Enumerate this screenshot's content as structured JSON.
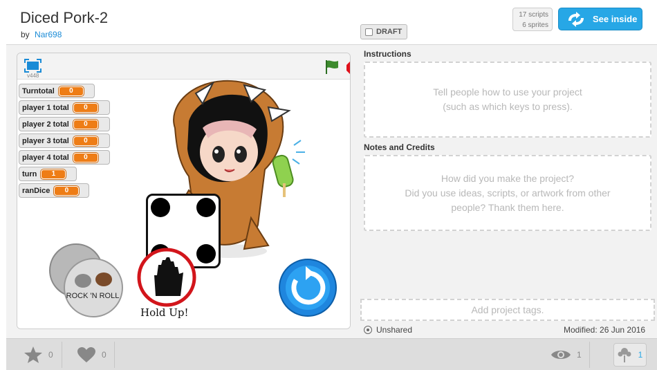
{
  "header": {
    "title": "Diced Pork-2",
    "by_label": "by",
    "author": "Nar698",
    "draft_label": "DRAFT",
    "scripts_count": "17 scripts",
    "sprites_count": "6 sprites",
    "see_inside_label": "See inside"
  },
  "player": {
    "version": "v448",
    "variables": [
      {
        "name": "Turntotal",
        "value": "0"
      },
      {
        "name": "player 1 total",
        "value": "0"
      },
      {
        "name": "player 2 total",
        "value": "0"
      },
      {
        "name": "player 3 total",
        "value": "0"
      },
      {
        "name": "player 4 total",
        "value": "0"
      },
      {
        "name": "turn",
        "value": "1"
      },
      {
        "name": "ranDice",
        "value": "0"
      }
    ],
    "dice_face": 4,
    "button_text": "ROCK 'N ROLL",
    "sign_label": "Hold Up!"
  },
  "instructions": {
    "label": "Instructions",
    "placeholder_line1": "Tell people how to use your project",
    "placeholder_line2": "(such as which keys to press)."
  },
  "notes": {
    "label": "Notes and Credits",
    "placeholder_line1": "How did you make the project?",
    "placeholder_line2": "Did you use ideas, scripts, or artwork from other",
    "placeholder_line3": "people? Thank them here."
  },
  "tags": {
    "placeholder": "Add project tags."
  },
  "status": {
    "unshared": "Unshared",
    "modified": "Modified: 26 Jun 2016"
  },
  "stats": {
    "favorites": "0",
    "loves": "0",
    "views": "1",
    "remixes": "1"
  },
  "colors": {
    "accent": "#27a7e6",
    "variable_orange": "#ee7d16",
    "flag_green": "#3d8a2e",
    "stop_red": "#e0101a"
  }
}
